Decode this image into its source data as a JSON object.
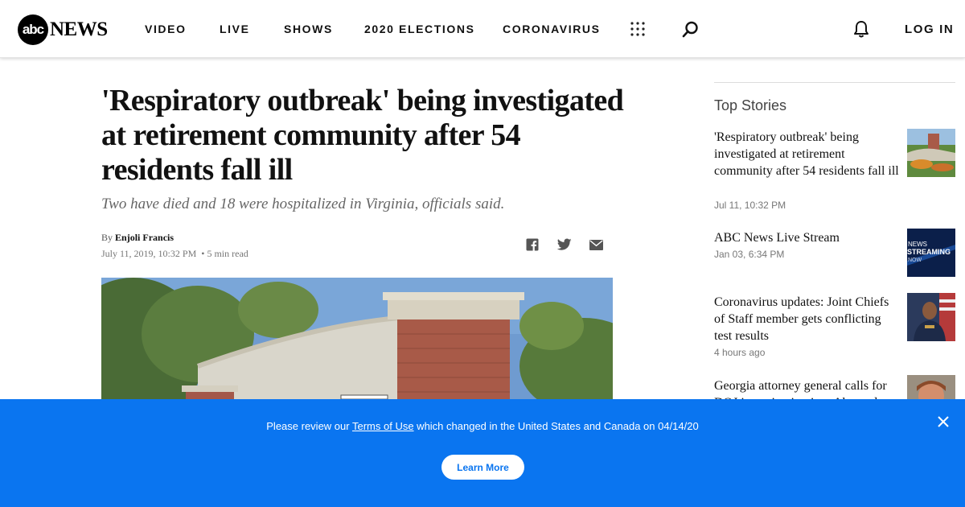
{
  "brand": {
    "logo_mark": "abc",
    "logo_text": "NEWS"
  },
  "nav": {
    "items": [
      {
        "label": "VIDEO"
      },
      {
        "label": "LIVE"
      },
      {
        "label": "SHOWS"
      },
      {
        "label": "2020 ELECTIONS"
      },
      {
        "label": "CORONAVIRUS"
      }
    ],
    "icons": [
      "grid-menu-icon",
      "search-icon",
      "bell-icon"
    ],
    "login_label": "LOG IN"
  },
  "article": {
    "headline": "'Respiratory outbreak' being investigated at retirement community after 54 residents fall ill",
    "subhead": "Two have died and 18 were hospitalized in Virginia, officials said.",
    "byline_prefix": "By",
    "author": "Enjoli Francis",
    "date": "July 11, 2019, 10:32 PM",
    "read_time": "• 5 min read",
    "share_icons": [
      "facebook-icon",
      "twitter-icon",
      "email-icon"
    ]
  },
  "sidebar": {
    "title": "Top Stories",
    "stories": [
      {
        "title": "'Respiratory outbreak' being investigated at retirement community after 54 residents fall ill",
        "time": "Jul 11, 10:32 PM"
      },
      {
        "title": "ABC News Live Stream",
        "time": "Jan 03, 6:34 PM",
        "thumb_text": "NEWS STREAMING NOW"
      },
      {
        "title": "Coronavirus updates: Joint Chiefs of Staff member gets conflicting test results",
        "time": "4 hours ago"
      },
      {
        "title": "Georgia attorney general calls for DOJ investigation into Ahmaud",
        "time": ""
      }
    ]
  },
  "banner": {
    "text_before": "Please review our ",
    "link_text": "Terms of Use",
    "text_after": " which changed in the United States and Canada on 04/14/20",
    "button_label": "Learn More"
  },
  "colors": {
    "banner_bg": "#0a75f0",
    "text": "#111111"
  }
}
